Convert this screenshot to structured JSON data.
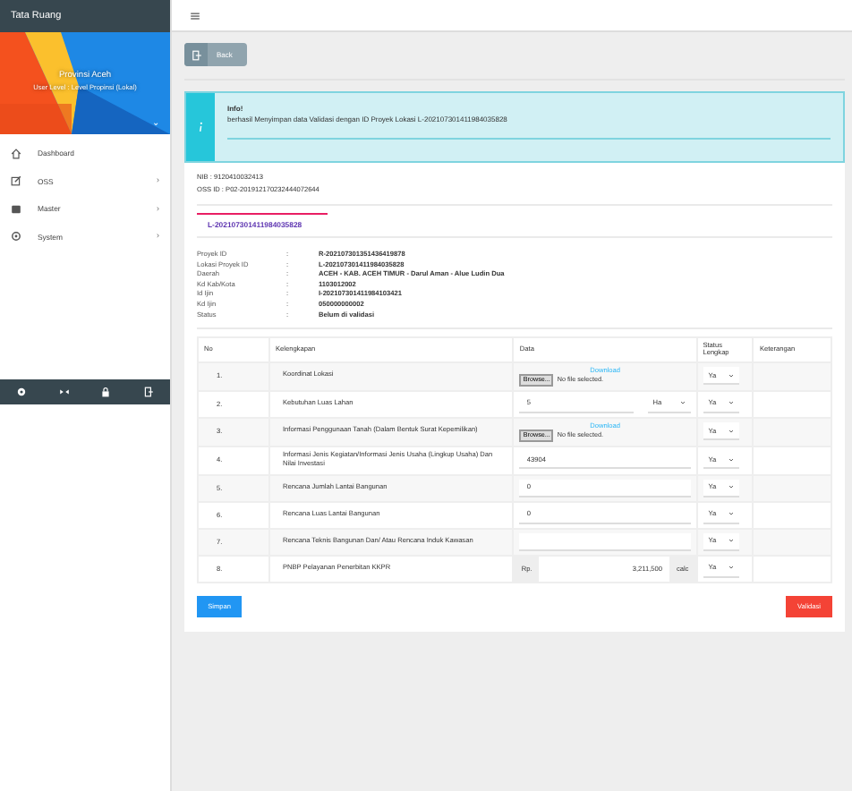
{
  "app_title": "Tata Ruang",
  "profile": {
    "name": "Provinsi Aceh",
    "role": "User Level : Level Propinsi (Lokal)",
    "caret": "⌄"
  },
  "menu": [
    {
      "label": "Dashboard"
    },
    {
      "label": "OSS",
      "arrow": "›"
    },
    {
      "label": "Master",
      "arrow": "›"
    },
    {
      "label": "System",
      "arrow": "›"
    }
  ],
  "back_button": "Back",
  "alert": {
    "title": "Info!",
    "message": "berhasil Menyimpan data Validasi dengan ID Proyek Lokasi L-202107301411984035828"
  },
  "nib": "NIB : 9120410032413",
  "oss_id": "OSS ID : P02-201912170232444072644",
  "location_id": "L-202107301411984035828",
  "details": [
    {
      "label": "Proyek ID",
      "sep": ":",
      "value": "R-202107301351436419878"
    },
    {
      "label": "Lokasi Proyek ID",
      "sep": ":",
      "value": "L-202107301411984035828"
    },
    {
      "label": "Daerah",
      "sep": ":",
      "value": "ACEH - KAB. ACEH TIMUR - Darul Aman - Alue Ludin Dua"
    },
    {
      "label": "Kd Kab/Kota",
      "sep": ":",
      "value": "1103012002"
    },
    {
      "label": "Id Ijin",
      "sep": ":",
      "value": "I-202107301411984103421"
    },
    {
      "label": "Kd Ijin",
      "sep": ":",
      "value": "050000000002"
    },
    {
      "label": "Status",
      "sep": ":",
      "value": "Belum di validasi"
    }
  ],
  "table": {
    "columns": [
      "No",
      "Kelengkapan",
      "Data",
      "Status Lengkap",
      "Keterangan"
    ],
    "rows": [
      {
        "no": "1.",
        "item": "Koordinat Lokasi",
        "kind": "file",
        "link": "Download",
        "browse": "Browse...",
        "file_status": "No file selected.",
        "status": "Ya"
      },
      {
        "no": "2.",
        "item": "Kebutuhan Luas Lahan",
        "kind": "area",
        "value": "5",
        "unit": "Ha",
        "status": "Ya"
      },
      {
        "no": "3.",
        "item": "Informasi Penggunaan Tanah (Dalam Bentuk Surat Kepemilikan)",
        "kind": "file",
        "link": "Download",
        "browse": "Browse...",
        "file_status": "No file selected.",
        "status": "Ya"
      },
      {
        "no": "4.",
        "item": "Informasi Jenis Kegiatan/Informasi Jenis Usaha (Lingkup Usaha) Dan Nilai Investasi",
        "kind": "text",
        "value": "43904",
        "status": "Ya"
      },
      {
        "no": "5.",
        "item": "Rencana Jumlah Lantai Bangunan",
        "kind": "text",
        "value": "0",
        "status": "Ya"
      },
      {
        "no": "6.",
        "item": "Rencana Luas Lantai Bangunan",
        "kind": "text",
        "value": "0",
        "status": "Ya"
      },
      {
        "no": "7.",
        "item": "Rencana Teknis Bangunan Dan/ Atau Rencana Induk Kawasan",
        "kind": "text",
        "status": "Ya"
      },
      {
        "no": "8.",
        "item": "PNBP Pelayanan Penerbitan KKPR",
        "kind": "money",
        "prefix": "Rp.",
        "value": "3,211,500",
        "suffix": "calc",
        "status": "Ya"
      }
    ]
  },
  "save_button": "Simpan",
  "validate_button": "Validasi"
}
